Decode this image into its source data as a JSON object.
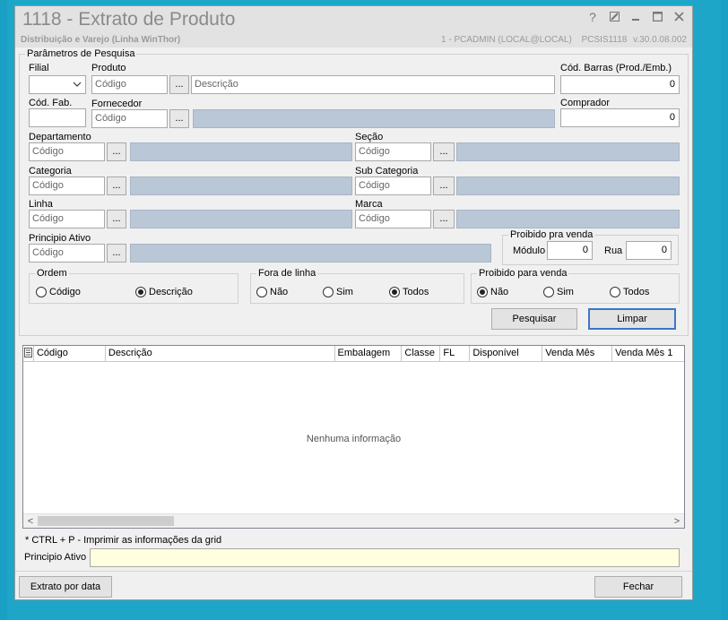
{
  "window": {
    "title": "1118 - Extrato de Produto",
    "subtitle": "Distribuição e Varejo (Linha WinThor)",
    "user": "1 - PCADMIN (LOCAL@LOCAL)",
    "routine": "PCSIS1118",
    "version": "v.30.0.08.002",
    "controls": [
      "help-icon",
      "restore-icon",
      "minimize-icon",
      "maximize-icon",
      "close-icon"
    ]
  },
  "params": {
    "legend": "Parâmetros de Pesquisa",
    "filial_label": "Filial",
    "produto_label": "Produto",
    "produto_code_placeholder": "Código",
    "produto_desc_placeholder": "Descrição",
    "cod_barras_label": "Cód. Barras (Prod./Emb.)",
    "cod_barras_value": "0",
    "cod_fab_label": "Cód. Fab.",
    "fornecedor_label": "Fornecedor",
    "fornecedor_placeholder": "Código",
    "comprador_label": "Comprador",
    "comprador_value": "0",
    "departamento_label": "Departamento",
    "departamento_placeholder": "Código",
    "secao_label": "Seção",
    "secao_placeholder": "Código",
    "categoria_label": "Categoria",
    "categoria_placeholder": "Código",
    "subcategoria_label": "Sub Categoria",
    "subcategoria_placeholder": "Código",
    "linha_label": "Linha",
    "linha_placeholder": "Código",
    "marca_label": "Marca",
    "marca_placeholder": "Código",
    "principio_label": "Principio Ativo",
    "principio_placeholder": "Código",
    "ellipsis": "...",
    "proibido_group": {
      "legend": "Proibido pra venda",
      "modulo_label": "Módulo",
      "modulo_value": "0",
      "rua_label": "Rua",
      "rua_value": "0"
    },
    "ordem": {
      "legend": "Ordem",
      "options": [
        "Código",
        "Descrição"
      ],
      "selected": "Descrição"
    },
    "fora_linha": {
      "legend": "Fora de linha",
      "options": [
        "Não",
        "Sim",
        "Todos"
      ],
      "selected": "Todos"
    },
    "proibido_venda": {
      "legend": "Proibido para venda",
      "options": [
        "Não",
        "Sim",
        "Todos"
      ],
      "selected": "Não"
    },
    "pesquisar": "Pesquisar",
    "limpar": "Limpar"
  },
  "grid": {
    "columns": [
      "Código",
      "Descrição",
      "Embalagem",
      "Classe",
      "FL",
      "Disponível",
      "Venda Mês",
      "Venda Mês 1"
    ],
    "empty_text": "Nenhuma informação"
  },
  "footer": {
    "hint": "* CTRL + P - Imprimir as informações da grid",
    "principio_label": "Principio Ativo",
    "principio_value": "",
    "extrato_button": "Extrato por data",
    "fechar_button": "Fechar"
  },
  "colors": {
    "background": "#1ea6c9",
    "disabled_field": "#b9c7d6",
    "highlight_field": "#ffffe0",
    "focus_border": "#3a78c9"
  }
}
